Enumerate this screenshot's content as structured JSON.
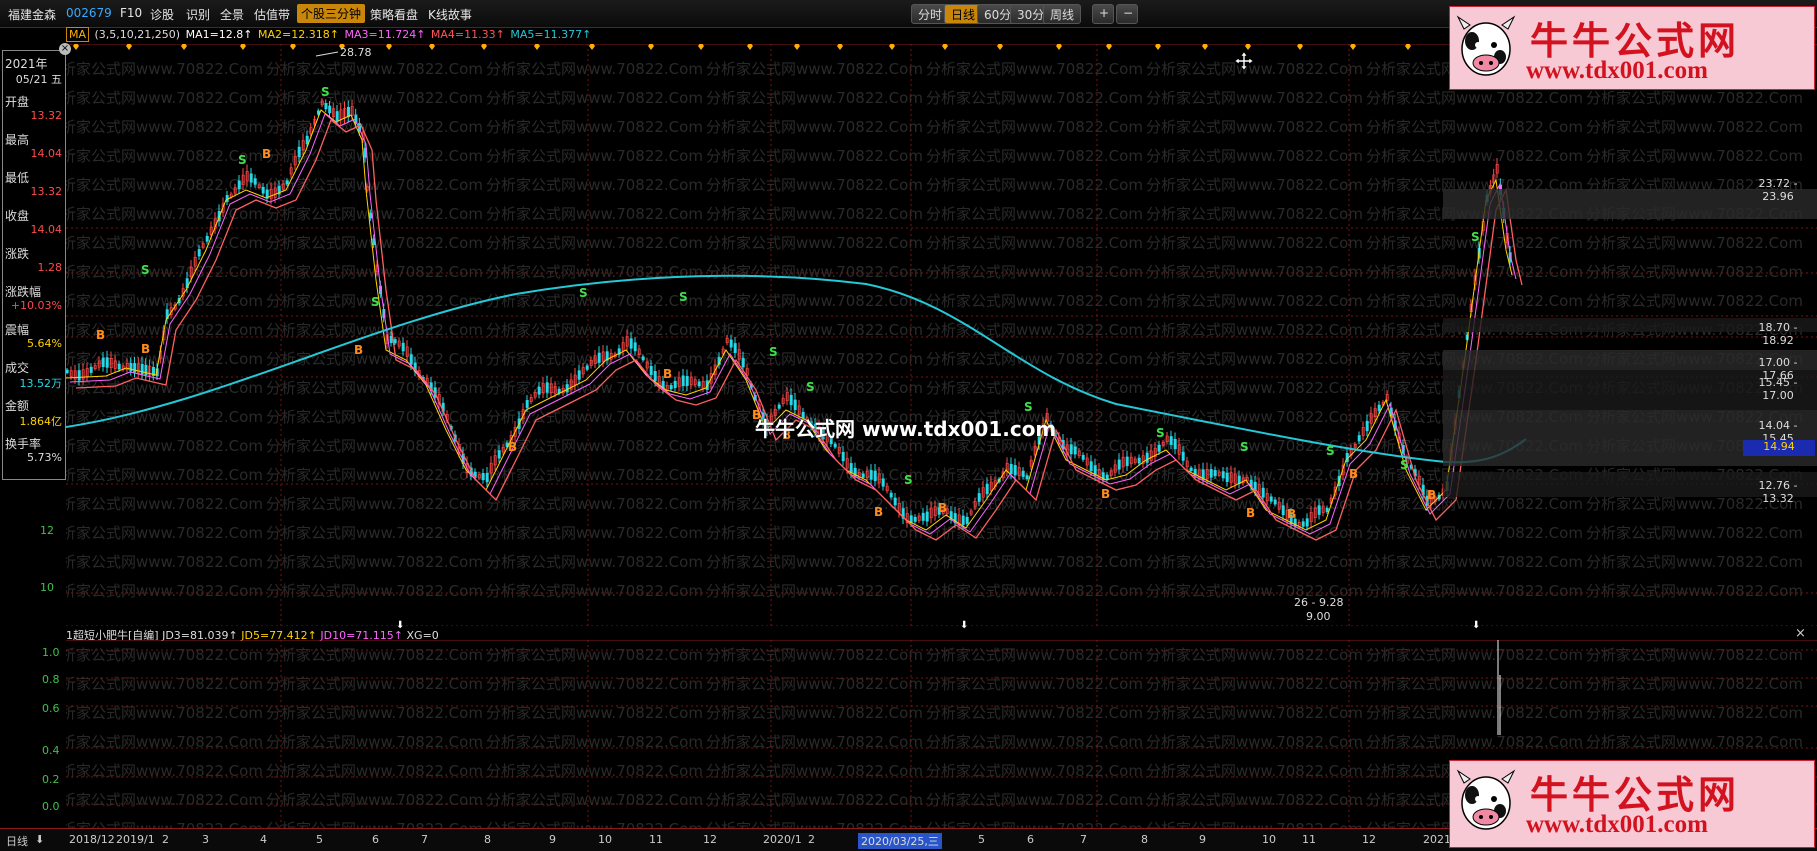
{
  "toolbar": {
    "stock_name": "福建金森",
    "stock_code": "002679",
    "menu": [
      "F10",
      "诊股",
      "识别",
      "全景",
      "估值带"
    ],
    "active_tab": "个股三分钟",
    "menu2": [
      "策略看盘",
      "K线故事"
    ],
    "periods": [
      "分时",
      "日线",
      "60分",
      "30分",
      "周线"
    ],
    "active_period": "日线",
    "zoom_in": "+",
    "zoom_out": "−"
  },
  "indicator_bar": {
    "selector": "MA",
    "params": "(3,5,10,21,250)",
    "ma1": "MA1=12.8↑",
    "ma2": "MA2=12.318↑",
    "ma3": "MA3=11.724↑",
    "ma4": "MA4=11.33↑",
    "ma5": "MA5=11.377↑"
  },
  "info_panel": {
    "year": "2021年",
    "date": "05/21 五",
    "open_label": "开盘",
    "open": "13.32",
    "high_label": "最高",
    "high": "14.04",
    "low_label": "最低",
    "low": "13.32",
    "close_label": "收盘",
    "close": "14.04",
    "change_label": "涨跌",
    "change": "1.28",
    "pct_label": "涨跌幅",
    "pct": "+10.03%",
    "amp_label": "震幅",
    "amp": "5.64%",
    "vol_label": "成交",
    "vol": "13.52万",
    "amount_label": "金额",
    "amount": "1.864亿",
    "turnover_label": "换手率",
    "turnover": "5.73%"
  },
  "left_axis": [
    "12",
    "10"
  ],
  "sub_axis": [
    "1.0",
    "0.8",
    "0.6",
    "0.4",
    "0.2",
    "0.0"
  ],
  "annotations": {
    "high_mark": "28.78",
    "low_mark": "9.00",
    "low_range": "26 - 9.28",
    "zones": [
      "23.72 - 23.96",
      "18.70 - 18.92",
      "17.00 - 17.66",
      "15.45 - 17.00",
      "14.04 - 15.45",
      "12.76 - 13.32"
    ],
    "cursor_price": "14.94"
  },
  "sub_indicator": {
    "name": "1超短小肥牛[自编]",
    "jd3": "JD3=81.039↑",
    "jd5": "JD5=77.412↑",
    "jd10": "JD10=71.115↑",
    "xg": "XG=0"
  },
  "time_axis": {
    "period_btn": "日线",
    "labels": [
      "2018/12",
      "2019/1",
      "2",
      "3",
      "4",
      "5",
      "6",
      "7",
      "8",
      "9",
      "10",
      "11",
      "12",
      "2020/1",
      "2",
      "2020/03/25,三",
      "5",
      "6",
      "7",
      "8",
      "9",
      "10",
      "11",
      "12",
      "2021"
    ]
  },
  "watermark": {
    "repeat": "分析家公式网www.70822.Com",
    "center": "牛牛公式网 www.tdx001.com"
  },
  "ad": {
    "title": "牛牛公式网",
    "url": "www.tdx001.com"
  },
  "colors": {
    "up": "#ff4a4a",
    "down": "#27d9e6",
    "ma250": "#25c8d6",
    "ma_red": "#ff6060",
    "grid": "#7a1414",
    "accent": "#c8860a"
  }
}
